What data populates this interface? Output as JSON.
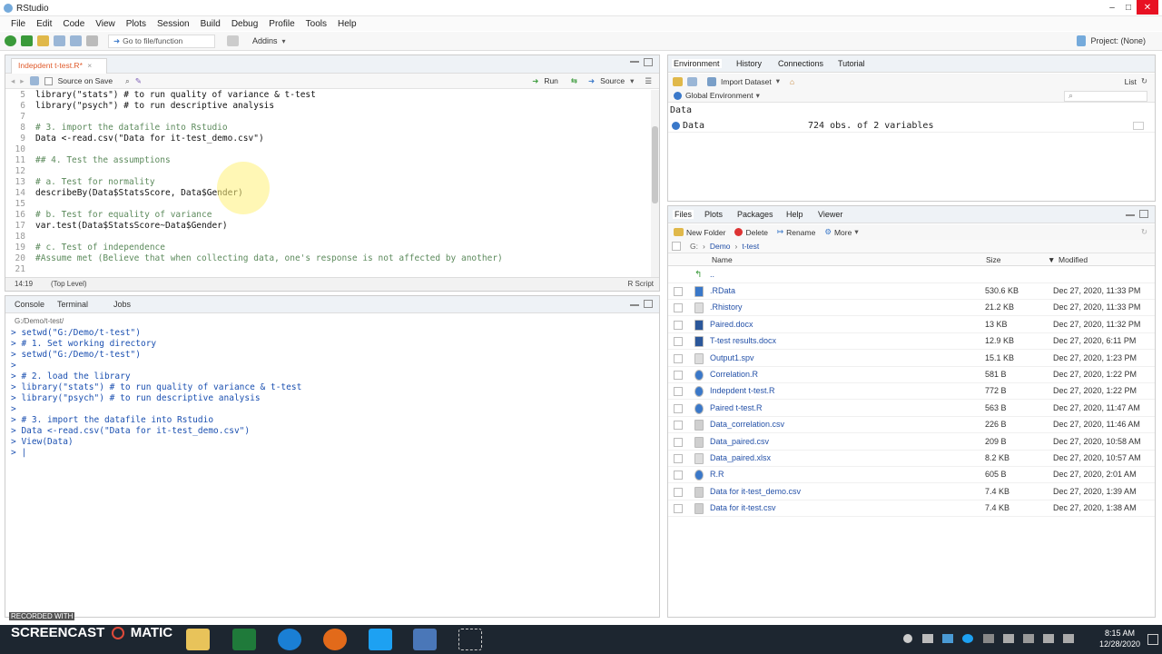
{
  "window": {
    "title": "RStudio"
  },
  "menu": [
    "File",
    "Edit",
    "Code",
    "View",
    "Plots",
    "Session",
    "Build",
    "Debug",
    "Profile",
    "Tools",
    "Help"
  ],
  "toolbar": {
    "goto_placeholder": "Go to file/function",
    "addins": "Addins",
    "project": "Project: (None)"
  },
  "source": {
    "tab": "Indepdent t-test.R*",
    "source_on_save": "Source on Save",
    "run": "Run",
    "source_btn": "Source",
    "status_pos": "14:19",
    "status_scope": "(Top Level)",
    "status_type": "R Script",
    "lines": [
      {
        "n": "5",
        "t": "library(\"stats\") # to run quality of variance & t-test"
      },
      {
        "n": "6",
        "t": "library(\"psych\") # to run descriptive analysis"
      },
      {
        "n": "7",
        "t": ""
      },
      {
        "n": "8",
        "t": "# 3. import the datafile into Rstudio"
      },
      {
        "n": "9",
        "t": "Data <-read.csv(\"Data for it-test_demo.csv\")"
      },
      {
        "n": "10",
        "t": ""
      },
      {
        "n": "11",
        "t": "## 4. Test the assumptions"
      },
      {
        "n": "12",
        "t": ""
      },
      {
        "n": "13",
        "t": "# a. Test for normality"
      },
      {
        "n": "14",
        "t": "describeBy(Data$StatsScore, Data$Gender)"
      },
      {
        "n": "15",
        "t": ""
      },
      {
        "n": "16",
        "t": "# b. Test for equality of variance"
      },
      {
        "n": "17",
        "t": "var.test(Data$StatsScore~Data$Gender)"
      },
      {
        "n": "18",
        "t": ""
      },
      {
        "n": "19",
        "t": "# c. Test of independence"
      },
      {
        "n": "20",
        "t": "#Assume met (Believe that when collecting data, one's response is not affected by another)"
      },
      {
        "n": "21",
        "t": ""
      }
    ]
  },
  "console": {
    "tabs": [
      "Console",
      "Terminal",
      "Jobs"
    ],
    "path": "G:/Demo/t-test/",
    "lines": [
      "> setwd(\"G:/Demo/t-test\")",
      "> # 1. Set working directory",
      "> setwd(\"G:/Demo/t-test\")",
      ">",
      "> # 2. load the library",
      "> library(\"stats\") # to run quality of variance & t-test",
      "> library(\"psych\") # to run descriptive analysis",
      ">",
      "> # 3. import the datafile into Rstudio",
      "> Data <-read.csv(\"Data for it-test_demo.csv\")",
      "> View(Data)",
      "> |"
    ]
  },
  "env": {
    "tabs": [
      "Environment",
      "History",
      "Connections",
      "Tutorial"
    ],
    "import": "Import Dataset",
    "list": "List",
    "global": "Global Environment",
    "section": "Data",
    "row": {
      "name": "Data",
      "value": "724 obs. of 2 variables"
    }
  },
  "files": {
    "tabs": [
      "Files",
      "Plots",
      "Packages",
      "Help",
      "Viewer"
    ],
    "new_folder": "New Folder",
    "delete": "Delete",
    "rename": "Rename",
    "more": "More",
    "crumb": [
      "G:",
      "Demo",
      "t-test"
    ],
    "col_name": "Name",
    "col_size": "Size",
    "col_modified": "Modified",
    "up": "..",
    "rows": [
      {
        "name": ".RData",
        "size": "530.6 KB",
        "mod": "Dec 27, 2020, 11:33 PM",
        "icon": "rdata-icon"
      },
      {
        "name": ".Rhistory",
        "size": "21.2 KB",
        "mod": "Dec 27, 2020, 11:33 PM",
        "icon": "file-icon"
      },
      {
        "name": "Paired.docx",
        "size": "13 KB",
        "mod": "Dec 27, 2020, 11:32 PM",
        "icon": "word-icon"
      },
      {
        "name": "T-test results.docx",
        "size": "12.9 KB",
        "mod": "Dec 27, 2020, 6:11 PM",
        "icon": "word-icon"
      },
      {
        "name": "Output1.spv",
        "size": "15.1 KB",
        "mod": "Dec 27, 2020, 1:23 PM",
        "icon": "file-icon"
      },
      {
        "name": "Correlation.R",
        "size": "581 B",
        "mod": "Dec 27, 2020, 1:22 PM",
        "icon": "r-icon"
      },
      {
        "name": "Indepdent t-test.R",
        "size": "772 B",
        "mod": "Dec 27, 2020, 1:22 PM",
        "icon": "r-icon"
      },
      {
        "name": "Paired t-test.R",
        "size": "563 B",
        "mod": "Dec 27, 2020, 11:47 AM",
        "icon": "r-icon"
      },
      {
        "name": "Data_correlation.csv",
        "size": "226 B",
        "mod": "Dec 27, 2020, 11:46 AM",
        "icon": "csv-icon"
      },
      {
        "name": "Data_paired.csv",
        "size": "209 B",
        "mod": "Dec 27, 2020, 10:58 AM",
        "icon": "csv-icon"
      },
      {
        "name": "Data_paired.xlsx",
        "size": "8.2 KB",
        "mod": "Dec 27, 2020, 10:57 AM",
        "icon": "file-icon"
      },
      {
        "name": "R.R",
        "size": "605 B",
        "mod": "Dec 27, 2020, 2:01 AM",
        "icon": "r-icon"
      },
      {
        "name": "Data for it-test_demo.csv",
        "size": "7.4 KB",
        "mod": "Dec 27, 2020, 1:39 AM",
        "icon": "csv-icon"
      },
      {
        "name": "Data for it-test.csv",
        "size": "7.4 KB",
        "mod": "Dec 27, 2020, 1:38 AM",
        "icon": "csv-icon"
      }
    ]
  },
  "taskbar": {
    "recorded": "RECORDED WITH",
    "brand": "SCREENCAST",
    "brand2": "MATIC",
    "time": "8:15 AM",
    "date": "12/28/2020"
  },
  "colors": {
    "accent": "#3a78c9",
    "r_blue": "#2f6fbf",
    "console_text": "#1a4fb0",
    "tab_orange": "#e05b2c",
    "taskbar": "#1d2630"
  }
}
